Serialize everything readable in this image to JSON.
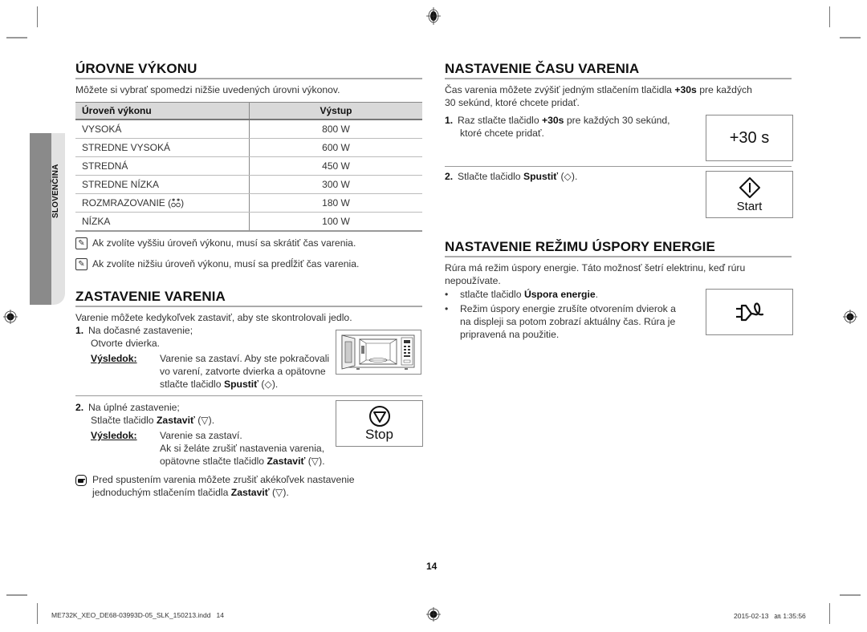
{
  "side_tab": {
    "label": "SLOVENČINA"
  },
  "left": {
    "power_levels": {
      "title": "ÚROVNE VÝKONU",
      "intro": "Môžete si vybrať spomedzi nižšie uvedených úrovni výkonov.",
      "table": {
        "headers": [
          "Úroveň výkonu",
          "Výstup"
        ],
        "rows": [
          {
            "level": "VYSOKÁ",
            "output": "800 W"
          },
          {
            "level": "STREDNE VYSOKÁ",
            "output": "600 W"
          },
          {
            "level": "STREDNÁ",
            "output": "450 W"
          },
          {
            "level": "STREDNE NÍZKA",
            "output": "300 W"
          },
          {
            "level": "ROZMRAZOVANIE",
            "icon": "defrost-icon",
            "output": "180 W"
          },
          {
            "level": "NÍZKA",
            "output": "100 W"
          }
        ]
      },
      "notes": [
        "Ak zvolíte vyššiu úroveň výkonu, musí sa skrátiť čas varenia.",
        "Ak zvolíte nižšiu úroveň výkonu, musí sa predĺžiť čas varenia."
      ]
    },
    "stop_cooking": {
      "title": "ZASTAVENIE VARENIA",
      "intro": "Varenie môžete kedykoľvek zastaviť, aby ste skontrolovali jedlo.",
      "step1": {
        "num": "1.",
        "line1": "Na dočasné zastavenie;",
        "line2": "Otvorte dvierka.",
        "result_label": "Výsledok:",
        "result_line1": "Varenie sa zastaví. Aby ste pokračovali",
        "result_line2": "vo varení, zatvorte dvierka a opätovne",
        "result_line3_pre": "stlačte tlačidlo ",
        "result_line3_bold": "Spustiť",
        "result_line3_post": " (◇)."
      },
      "step2": {
        "num": "2.",
        "line1": "Na úplné zastavenie;",
        "line2_pre": "Stlačte tlačidlo ",
        "line2_bold": "Zastaviť",
        "line2_post": " (▽).",
        "result_label": "Výsledok:",
        "result_line1": "Varenie sa zastaví.",
        "result_line2": "Ak si želáte zrušiť nastavenia varenia,",
        "result_line3_pre": "opätovne stlačte tlačidlo ",
        "result_line3_bold": "Zastaviť",
        "result_line3_post": " (▽)."
      },
      "stop_button_label": "Stop",
      "tip_line1": "Pred spustením varenia môžete zrušiť akékoľvek nastavenie",
      "tip_line2_pre": "jednoduchým stlačením tlačidla ",
      "tip_line2_bold": "Zastaviť",
      "tip_line2_post": " (▽)."
    }
  },
  "right": {
    "cook_time": {
      "title": "NASTAVENIE ČASU VARENIA",
      "intro_pre": "Čas varenia môžete zvýšiť jedným stlačením tlačidla ",
      "intro_bold": "+30s",
      "intro_post": " pre každých",
      "intro_line2": "30 sekúnd, ktoré chcete pridať.",
      "step1": {
        "num": "1.",
        "pre": "Raz stlačte tlačidlo ",
        "bold": "+30s",
        "post": " pre každých 30 sekúnd,",
        "line2": "ktoré chcete pridať."
      },
      "step2": {
        "num": "2.",
        "pre": "Stlačte tlačidlo ",
        "bold": "Spustiť",
        "post": " (◇)."
      },
      "plus30_button_label": "+30 s",
      "start_button_label": "Start"
    },
    "eco_mode": {
      "title": "NASTAVENIE REŽIMU ÚSPORY ENERGIE",
      "intro_line1": "Rúra má režim úspory energie. Táto možnosť šetrí elektrinu, keď rúru",
      "intro_line2": "nepoužívate.",
      "bullet1_pre": "stlačte tlačidlo ",
      "bullet1_bold": "Úspora energie",
      "bullet1_post": ".",
      "bullet2_line1": "Režim úspory energie zrušíte otvorením dvierok a",
      "bullet2_line2": "na displeji sa potom zobrazí aktuálny čas. Rúra je",
      "bullet2_line3": "pripravená na použitie."
    }
  },
  "page_number": "14",
  "footer": {
    "filename": "ME732K_XEO_DE68-03993D-05_SLK_150213.indd   14",
    "datetime": "2015-02-13   ㏂ 1:35:56"
  }
}
